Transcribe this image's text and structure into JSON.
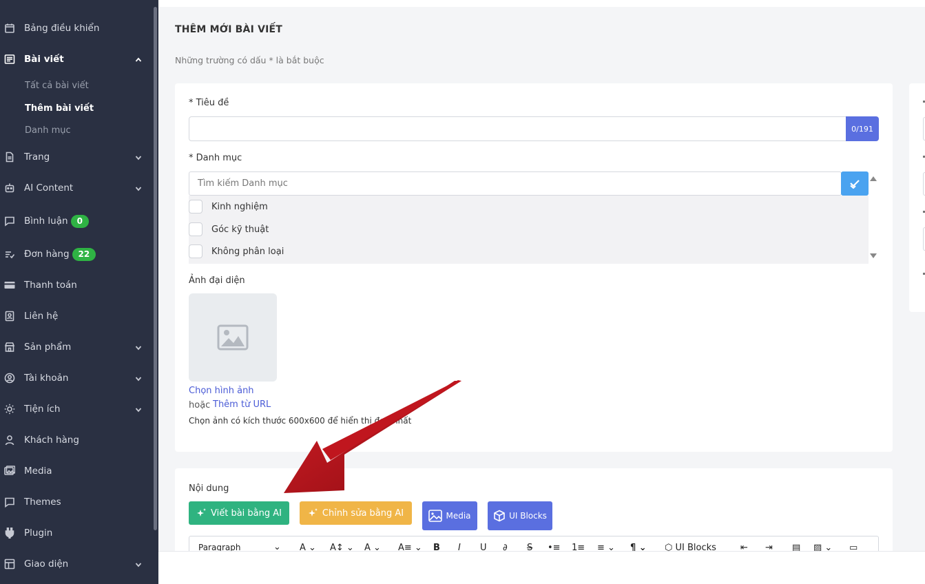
{
  "sidebar": {
    "items": [
      {
        "label": "Bảng điều khiển",
        "icon": "calendar-icon"
      },
      {
        "label": "Bài viết",
        "icon": "article-icon"
      },
      {
        "label": "Trang",
        "icon": "page-icon"
      },
      {
        "label": "AI Content",
        "icon": "robot-icon"
      },
      {
        "label": "Bình luận",
        "icon": "comment-icon",
        "badge": "0"
      },
      {
        "label": "Đơn hàng",
        "icon": "orders-icon",
        "badge": "22"
      },
      {
        "label": "Thanh toán",
        "icon": "credit-card-icon"
      },
      {
        "label": "Liên hệ",
        "icon": "contact-icon"
      },
      {
        "label": "Sản phẩm",
        "icon": "store-icon"
      },
      {
        "label": "Tài khoản",
        "icon": "user-circle-icon"
      },
      {
        "label": "Tiện ích",
        "icon": "sun-icon"
      },
      {
        "label": "Khách hàng",
        "icon": "user-icon"
      },
      {
        "label": "Media",
        "icon": "images-icon"
      },
      {
        "label": "Themes",
        "icon": "chat-square-icon"
      },
      {
        "label": "Plugin",
        "icon": "plug-icon"
      },
      {
        "label": "Giao diện",
        "icon": "layout-icon"
      }
    ],
    "sub_items": [
      "Tất cả bài viết",
      "Thêm bài viết",
      "Danh mục"
    ]
  },
  "page": {
    "title": "THÊM MỚI BÀI VIẾT",
    "subtitle": "Những trường có dấu * là bắt buộc"
  },
  "form": {
    "title_label": "* Tiêu đề",
    "title_value": "",
    "title_counter": "0/191",
    "category_label": "* Danh mục",
    "category_search_placeholder": "Tìm kiếm Danh mục",
    "categories": [
      "Kinh nghiệm",
      "Góc kỹ thuật",
      "Không phân loại"
    ],
    "image_label": "Ảnh đại diện",
    "choose_image": "Chọn hình ảnh",
    "or_text": "hoặc",
    "add_from_url": "Thêm từ URL",
    "image_hint": "Chọn ảnh có kích thước 600x600 để hiển thị đẹp nhất"
  },
  "content": {
    "label": "Nội dung",
    "btn_write_ai": "Viết bài bằng AI",
    "btn_edit_ai": "Chỉnh sửa bằng AI",
    "btn_media": "Media",
    "btn_ui_blocks": "UI Blocks",
    "toolbar": {
      "paragraph": "Paragraph",
      "ui_blocks": "UI Blocks"
    }
  },
  "colors": {
    "sidebar_bg": "#2a3042",
    "accent_blue": "#5a6fe0",
    "green": "#2fb380",
    "orange": "#f0b547",
    "badge_green": "#2fb344",
    "arrow_red": "#b3121a"
  }
}
